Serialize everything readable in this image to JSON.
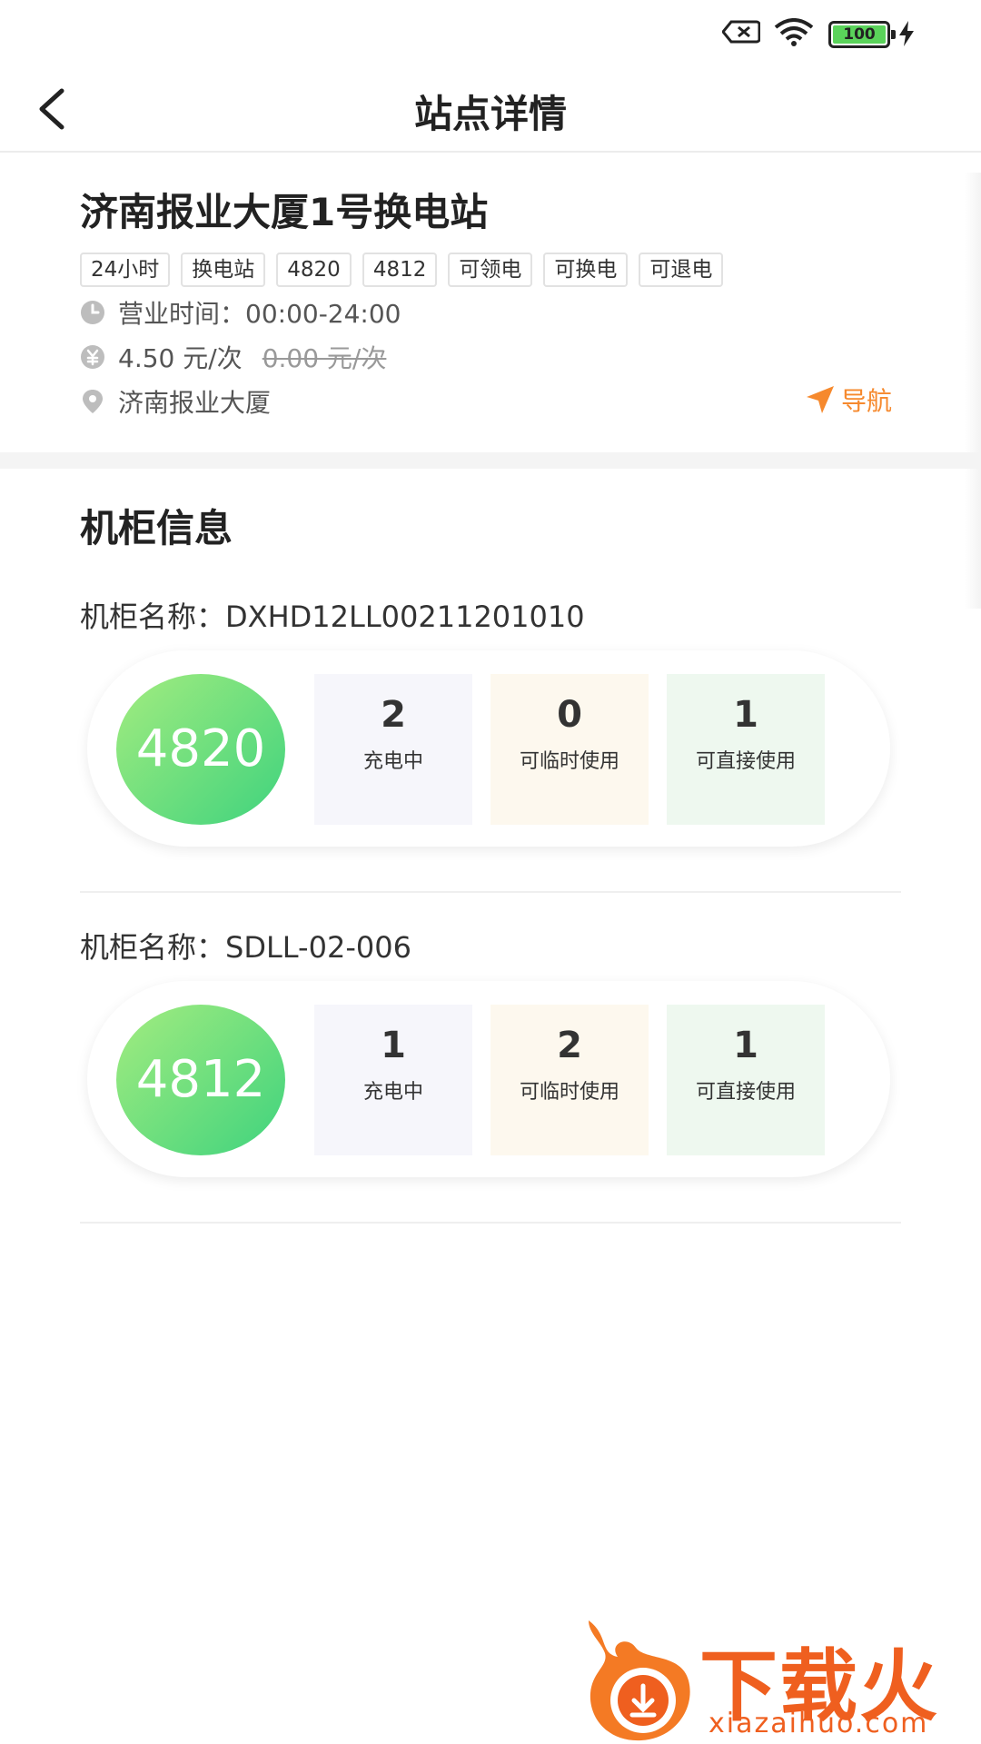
{
  "status_bar": {
    "battery": "100"
  },
  "header": {
    "title": "站点详情"
  },
  "station": {
    "name": "济南报业大厦1号换电站",
    "tags": [
      "24小时",
      "换电站",
      "4820",
      "4812",
      "可领电",
      "可换电",
      "可退电"
    ],
    "hours": "营业时间：00:00-24:00",
    "price": "4.50 元/次",
    "original_price": "0.00 元/次",
    "address": "济南报业大厦",
    "nav_label": "导航"
  },
  "cabinets_section": {
    "title": "机柜信息",
    "cabinets": [
      {
        "name": "机柜名称：DXHD12LL00211201010",
        "model": "4820",
        "stats": [
          {
            "value": "2",
            "label": "充电中"
          },
          {
            "value": "0",
            "label": "可临时使用"
          },
          {
            "value": "1",
            "label": "可直接使用"
          }
        ]
      },
      {
        "name": "机柜名称：SDLL-02-006",
        "model": "4812",
        "stats": [
          {
            "value": "1",
            "label": "充电中"
          },
          {
            "value": "2",
            "label": "可临时使用"
          },
          {
            "value": "1",
            "label": "可直接使用"
          }
        ]
      }
    ]
  },
  "watermark": {
    "text": "下载火",
    "url": "xiazaihuo.com"
  },
  "colors": {
    "accent_orange": "#f6892d",
    "green_start": "#a3ec7f",
    "green_end": "#3fd37e",
    "watermark": "#ef5f1f"
  }
}
